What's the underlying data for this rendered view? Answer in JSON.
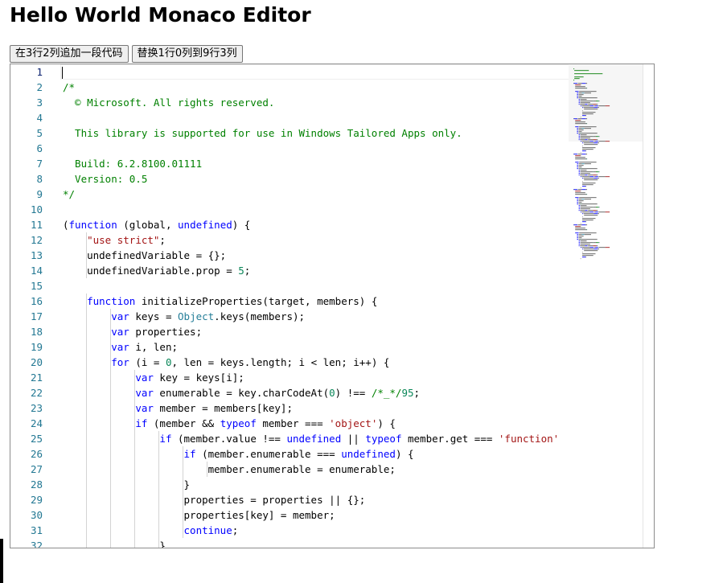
{
  "page": {
    "title": "Hello World Monaco Editor"
  },
  "toolbar": {
    "insert_label": "在3行2列追加一段代码",
    "replace_label": "替换1行0列到9行3列"
  },
  "colors": {
    "line_number": "#237893",
    "comment": "#008000",
    "keyword": "#0000ff",
    "string": "#a31515",
    "number": "#098658",
    "type": "#267f99"
  },
  "editor": {
    "active_line": 1,
    "code_lines": [
      [],
      [
        {
          "t": "/*",
          "c": "com"
        }
      ],
      [
        {
          "t": "  © Microsoft. All rights reserved.",
          "c": "com"
        }
      ],
      [],
      [
        {
          "t": "  This library is supported for use in Windows Tailored Apps only.",
          "c": "com"
        }
      ],
      [],
      [
        {
          "t": "  Build: 6.2.8100.01111",
          "c": "com"
        }
      ],
      [
        {
          "t": "  Version: 0.5",
          "c": "com"
        }
      ],
      [
        {
          "t": "*/",
          "c": "com"
        }
      ],
      [],
      [
        {
          "t": "("
        },
        {
          "t": "function",
          "c": "kw"
        },
        {
          "t": " (global, "
        },
        {
          "t": "undefined",
          "c": "kw"
        },
        {
          "t": ") {"
        }
      ],
      [
        {
          "t": "    "
        },
        {
          "t": "\"use strict\"",
          "c": "str"
        },
        {
          "t": ";"
        }
      ],
      [
        {
          "t": "    undefinedVariable = {};"
        }
      ],
      [
        {
          "t": "    undefinedVariable.prop = "
        },
        {
          "t": "5",
          "c": "num"
        },
        {
          "t": ";"
        }
      ],
      [],
      [
        {
          "t": "    "
        },
        {
          "t": "function",
          "c": "kw"
        },
        {
          "t": " initializeProperties(target, members) {"
        }
      ],
      [
        {
          "t": "        "
        },
        {
          "t": "var",
          "c": "kw"
        },
        {
          "t": " keys = "
        },
        {
          "t": "Object",
          "c": "typ"
        },
        {
          "t": ".keys(members);"
        }
      ],
      [
        {
          "t": "        "
        },
        {
          "t": "var",
          "c": "kw"
        },
        {
          "t": " properties;"
        }
      ],
      [
        {
          "t": "        "
        },
        {
          "t": "var",
          "c": "kw"
        },
        {
          "t": " i, len;"
        }
      ],
      [
        {
          "t": "        "
        },
        {
          "t": "for",
          "c": "kw"
        },
        {
          "t": " (i = "
        },
        {
          "t": "0",
          "c": "num"
        },
        {
          "t": ", len = keys.length; i < len; i++) {"
        }
      ],
      [
        {
          "t": "            "
        },
        {
          "t": "var",
          "c": "kw"
        },
        {
          "t": " key = keys[i];"
        }
      ],
      [
        {
          "t": "            "
        },
        {
          "t": "var",
          "c": "kw"
        },
        {
          "t": " enumerable = key.charCodeAt("
        },
        {
          "t": "0",
          "c": "num"
        },
        {
          "t": ") !== "
        },
        {
          "t": "/*_*/",
          "c": "com"
        },
        {
          "t": "95",
          "c": "num"
        },
        {
          "t": ";"
        }
      ],
      [
        {
          "t": "            "
        },
        {
          "t": "var",
          "c": "kw"
        },
        {
          "t": " member = members[key];"
        }
      ],
      [
        {
          "t": "            "
        },
        {
          "t": "if",
          "c": "kw"
        },
        {
          "t": " (member && "
        },
        {
          "t": "typeof",
          "c": "kw"
        },
        {
          "t": " member === "
        },
        {
          "t": "'object'",
          "c": "str"
        },
        {
          "t": ") {"
        }
      ],
      [
        {
          "t": "                "
        },
        {
          "t": "if",
          "c": "kw"
        },
        {
          "t": " (member.value !== "
        },
        {
          "t": "undefined",
          "c": "kw"
        },
        {
          "t": " || "
        },
        {
          "t": "typeof",
          "c": "kw"
        },
        {
          "t": " member.get === "
        },
        {
          "t": "'function'",
          "c": "str"
        }
      ],
      [
        {
          "t": "                    "
        },
        {
          "t": "if",
          "c": "kw"
        },
        {
          "t": " (member.enumerable === "
        },
        {
          "t": "undefined",
          "c": "kw"
        },
        {
          "t": ") {"
        }
      ],
      [
        {
          "t": "                        member.enumerable = enumerable;"
        }
      ],
      [
        {
          "t": "                    }"
        }
      ],
      [
        {
          "t": "                    properties = properties || {};"
        }
      ],
      [
        {
          "t": "                    properties[key] = member;"
        }
      ],
      [
        {
          "t": "                    "
        },
        {
          "t": "continue",
          "c": "kw"
        },
        {
          "t": ";"
        }
      ],
      [
        {
          "t": "                }"
        }
      ]
    ]
  }
}
